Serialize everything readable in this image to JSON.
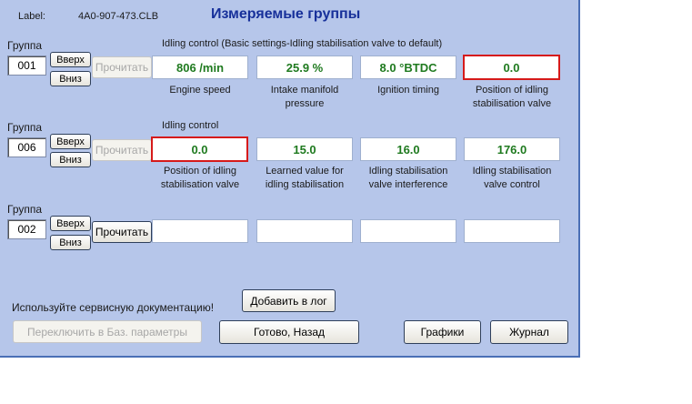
{
  "header": {
    "label_key": "Label:",
    "label_value": "4A0-907-473.CLB",
    "title": "Измеряемые группы"
  },
  "groups": [
    {
      "label": "Группа",
      "number": "001",
      "up": "Вверх",
      "down": "Вниз",
      "read": "Прочитать",
      "heading": "Idling control (Basic settings-Idling stabilisation valve to default)",
      "values": [
        "806 /min",
        "25.9 %",
        "8.0 °BTDC",
        "0.0"
      ],
      "captions": [
        [
          "Engine speed"
        ],
        [
          "Intake manifold",
          "pressure"
        ],
        [
          "Ignition timing"
        ],
        [
          "Position of idling",
          "stabilisation valve"
        ]
      ]
    },
    {
      "label": "Группа",
      "number": "006",
      "up": "Вверх",
      "down": "Вниз",
      "read": "Прочитать",
      "heading": "Idling control",
      "values": [
        "0.0",
        "15.0",
        "16.0",
        "176.0"
      ],
      "captions": [
        [
          "Position of idling",
          "stabilisation valve"
        ],
        [
          "Learned value for",
          "idling stabilisation"
        ],
        [
          "Idling stabilisation",
          "valve interference"
        ],
        [
          "Idling stabilisation",
          "valve control"
        ]
      ]
    },
    {
      "label": "Группа",
      "number": "002",
      "up": "Вверх",
      "down": "Вниз",
      "read": "Прочитать",
      "heading": "",
      "values": [
        "",
        "",
        "",
        ""
      ],
      "captions": [
        [
          ""
        ],
        [
          ""
        ],
        [
          ""
        ],
        [
          ""
        ]
      ]
    }
  ],
  "footer": {
    "notice": "Используйте сервисную документацию!",
    "add_log": "Добавить в лог",
    "switch_basic": "Переключить в Баз. параметры",
    "done_back": "Готово, Назад",
    "graphs": "Графики",
    "journal": "Журнал"
  }
}
